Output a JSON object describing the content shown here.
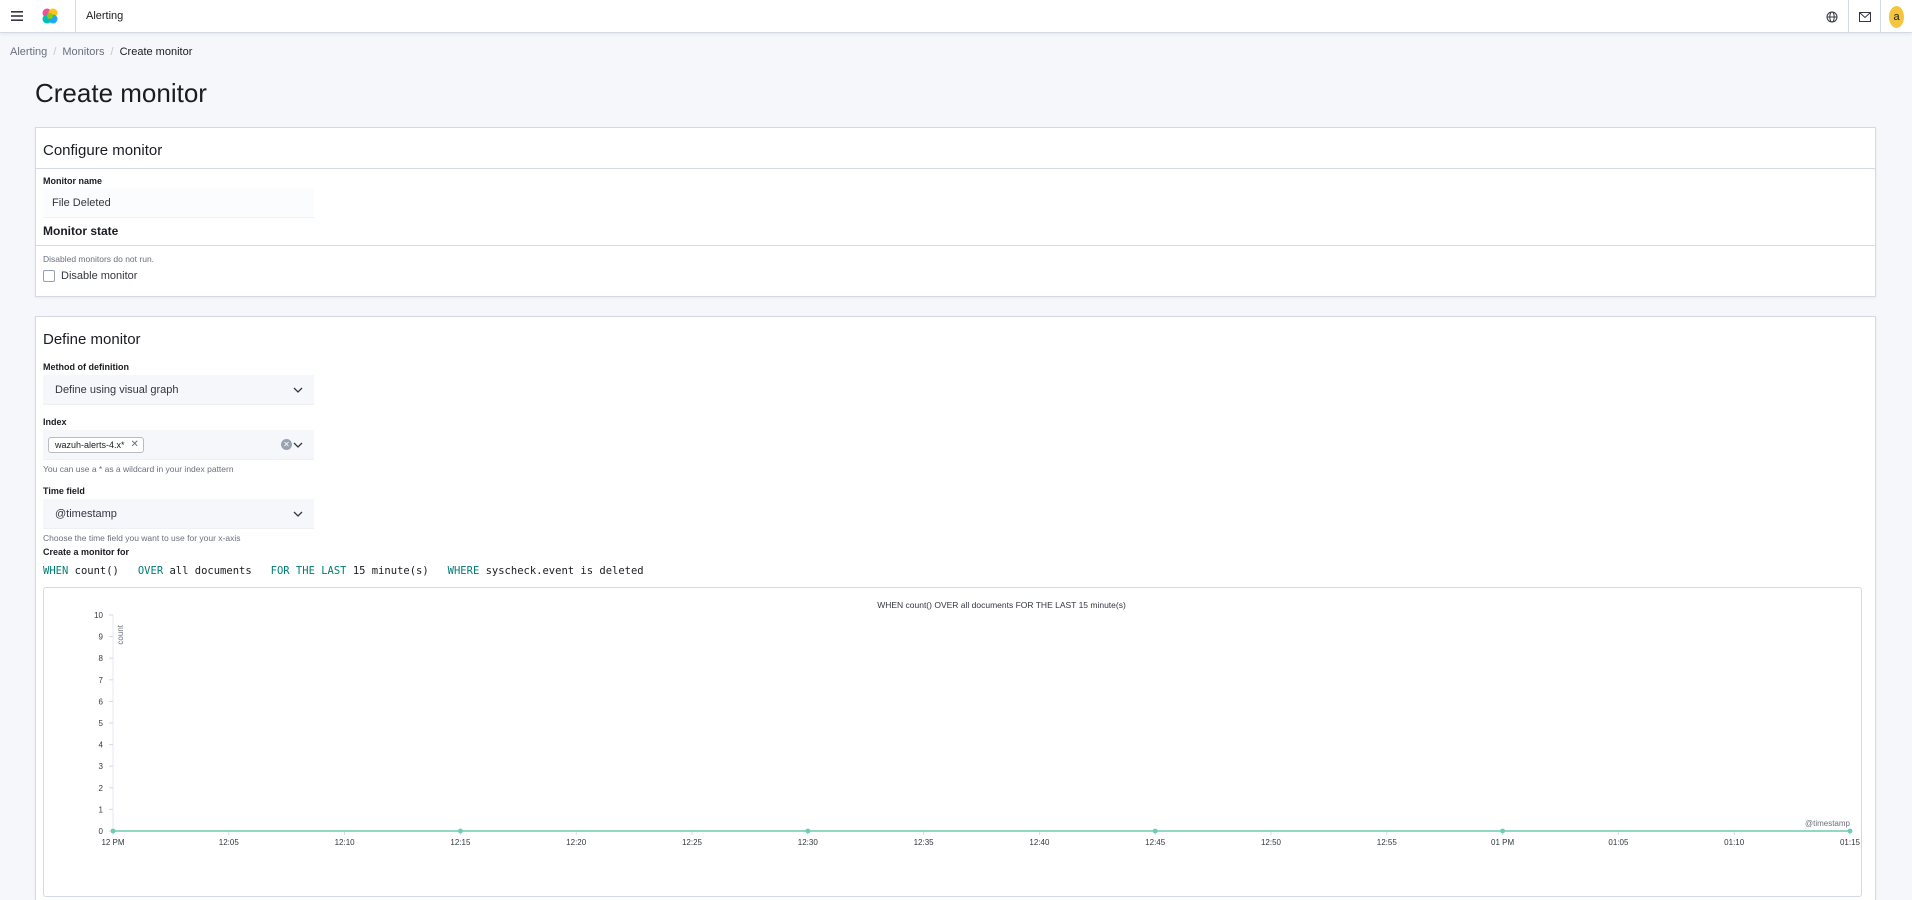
{
  "header": {
    "app_title": "Alerting",
    "avatar_initial": "a"
  },
  "breadcrumbs": [
    "Alerting",
    "Monitors",
    "Create monitor"
  ],
  "page_title": "Create monitor",
  "configure": {
    "title": "Configure monitor",
    "name_label": "Monitor name",
    "name_value": "File Deleted",
    "state_title": "Monitor state",
    "state_help": "Disabled monitors do not run.",
    "disable_label": "Disable monitor",
    "disabled": false
  },
  "define": {
    "title": "Define monitor",
    "method_label": "Method of definition",
    "method_value": "Define using visual graph",
    "index_label": "Index",
    "index_chip": "wazuh-alerts-4.x*",
    "index_help": "You can use a * as a wildcard in your index pattern",
    "time_label": "Time field",
    "time_value": "@timestamp",
    "time_help": "Choose the time field you want to use for your x-axis",
    "create_for_label": "Create a monitor for",
    "expression": {
      "when_kw": "WHEN",
      "when_val": "count()",
      "over_kw": "OVER",
      "over_val": "all documents",
      "for_kw": "FOR THE LAST",
      "for_val": "15 minute(s)",
      "where_kw": "WHERE",
      "where_val": "syscheck.event is deleted"
    }
  },
  "chart_data": {
    "type": "line",
    "title": "WHEN count() OVER all documents FOR THE LAST 15 minute(s)",
    "ylabel": "count",
    "xlabel": "@timestamp",
    "ylim": [
      0,
      10
    ],
    "yticks": [
      0,
      1,
      2,
      3,
      4,
      5,
      6,
      7,
      8,
      9,
      10
    ],
    "xticks": [
      "12 PM",
      "12:05",
      "12:10",
      "12:15",
      "12:20",
      "12:25",
      "12:30",
      "12:35",
      "12:40",
      "12:45",
      "12:50",
      "12:55",
      "01 PM",
      "01:05",
      "01:10",
      "01:15"
    ],
    "series": [
      {
        "x": [
          "12 PM",
          "12:15",
          "12:30",
          "12:45",
          "01 PM",
          "01:15"
        ],
        "values": [
          0,
          0,
          0,
          0,
          0,
          0
        ]
      }
    ],
    "color": "#6dccb1"
  }
}
